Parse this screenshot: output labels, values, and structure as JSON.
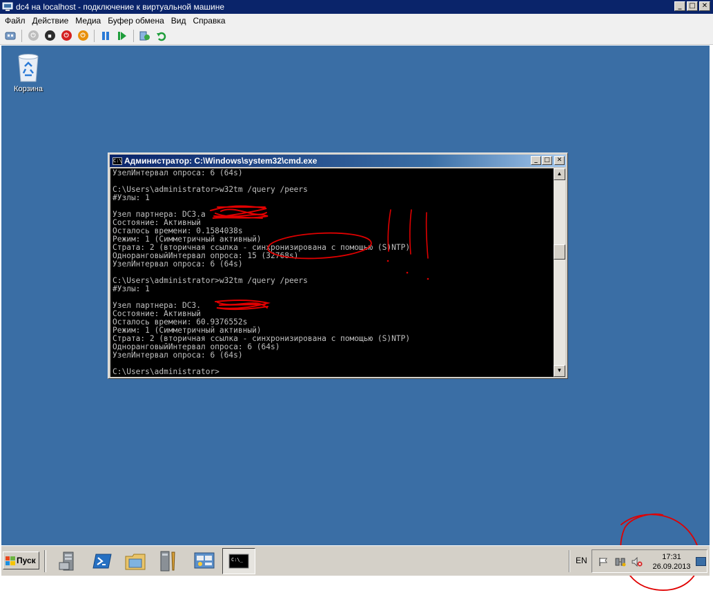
{
  "window": {
    "title": "dc4 на localhost - подключение к виртуальной машине",
    "controls": {
      "minimize": "_",
      "maximize": "□",
      "close": "✕"
    }
  },
  "menu": [
    "Файл",
    "Действие",
    "Медиа",
    "Буфер обмена",
    "Вид",
    "Справка"
  ],
  "toolbar": [
    "ctrl-alt-del-icon",
    "start-icon",
    "turn-off-icon",
    "shutdown-icon",
    "power-icon",
    "pause-icon",
    "reset-icon",
    "snapshot-icon",
    "revert-icon"
  ],
  "desktop": {
    "recycle_bin_label": "Корзина"
  },
  "cmd": {
    "title": "Администратор: C:\\Windows\\system32\\cmd.exe",
    "lines": [
      "УзелИнтервал опроса: 6 (64s)",
      "",
      "C:\\Users\\administrator>w32tm /query /peers",
      "#Узлы: 1",
      "",
      "Узел партнера: DC3.a",
      "Состояние: Активный",
      "Осталось времени: 0.1584038s",
      "Режим: 1 (Симметричный активный)",
      "Страта: 2 (вторичная ссылка - синхронизирована с помощью (S)NTP)",
      "ОдноранговыйИнтервал опроса: 15 (32768s)",
      "УзелИнтервал опроса: 6 (64s)",
      "",
      "C:\\Users\\administrator>w32tm /query /peers",
      "#Узлы: 1",
      "",
      "Узел партнера: DC3.",
      "Состояние: Активный",
      "Осталось времени: 60.9376552s",
      "Режим: 1 (Симметричный активный)",
      "Страта: 2 (вторичная ссылка - синхронизирована с помощью (S)NTP)",
      "ОдноранговыйИнтервал опроса: 6 (64s)",
      "УзелИнтервал опроса: 6 (64s)",
      "",
      "C:\\Users\\administrator>"
    ]
  },
  "taskbar": {
    "start_label": "Пуск",
    "apps": [
      "server-manager-icon",
      "powershell-icon",
      "explorer-icon",
      "admin-tools-icon",
      "control-panel-icon",
      "cmd-icon"
    ],
    "active_app": "cmd-icon",
    "language": "EN",
    "time": "17:31",
    "date": "26.09.2013"
  },
  "colors": {
    "desktop": "#3a6ea5",
    "title_active": "#0a246a",
    "console_text": "#c0c0c0",
    "annotation": "#e00000"
  }
}
